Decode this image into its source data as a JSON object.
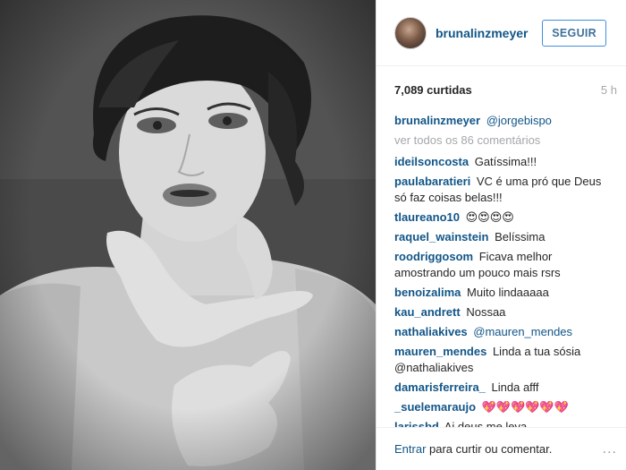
{
  "post": {
    "username": "brunalinzmeyer",
    "follow_label": "SEGUIR",
    "likes": "7,089 curtidas",
    "time": "5 h",
    "caption": {
      "user": "brunalinzmeyer",
      "text": "@jorgebispo"
    },
    "view_all": "ver todos os 86 comentários",
    "comments": [
      {
        "user": "ideilsoncosta",
        "text": "Gatíssima!!!"
      },
      {
        "user": "paulabaratieri",
        "text": "VC é uma pró que Deus só faz coisas belas!!!"
      },
      {
        "user": "tlaureano10",
        "text": "😍😍😍😍"
      },
      {
        "user": "raquel_wainstein",
        "text": "Belíssima"
      },
      {
        "user": "roodriggosom",
        "text": "Ficava melhor amostrando um pouco mais rsrs"
      },
      {
        "user": "benoizalima",
        "text": "Muito lindaaaaa"
      },
      {
        "user": "kau_andrett",
        "text": "Nossaa"
      },
      {
        "user": "nathaliakives",
        "text": "@mauren_mendes"
      },
      {
        "user": "mauren_mendes",
        "text": "Linda a tua sósia @nathaliakives"
      },
      {
        "user": "damarisferreira_",
        "text": "Linda afff"
      },
      {
        "user": "_suelemaraujo",
        "text": "💖💖💖💖💖💖"
      },
      {
        "user": "larissbd",
        "text": "Ai deus me leva"
      }
    ],
    "footer": {
      "enter": "Entrar",
      "rest": " para curtir ou comentar.",
      "more": "..."
    }
  },
  "colors": {
    "link": "#125688",
    "follow_border": "#4090db",
    "muted": "#a5a7aa"
  }
}
